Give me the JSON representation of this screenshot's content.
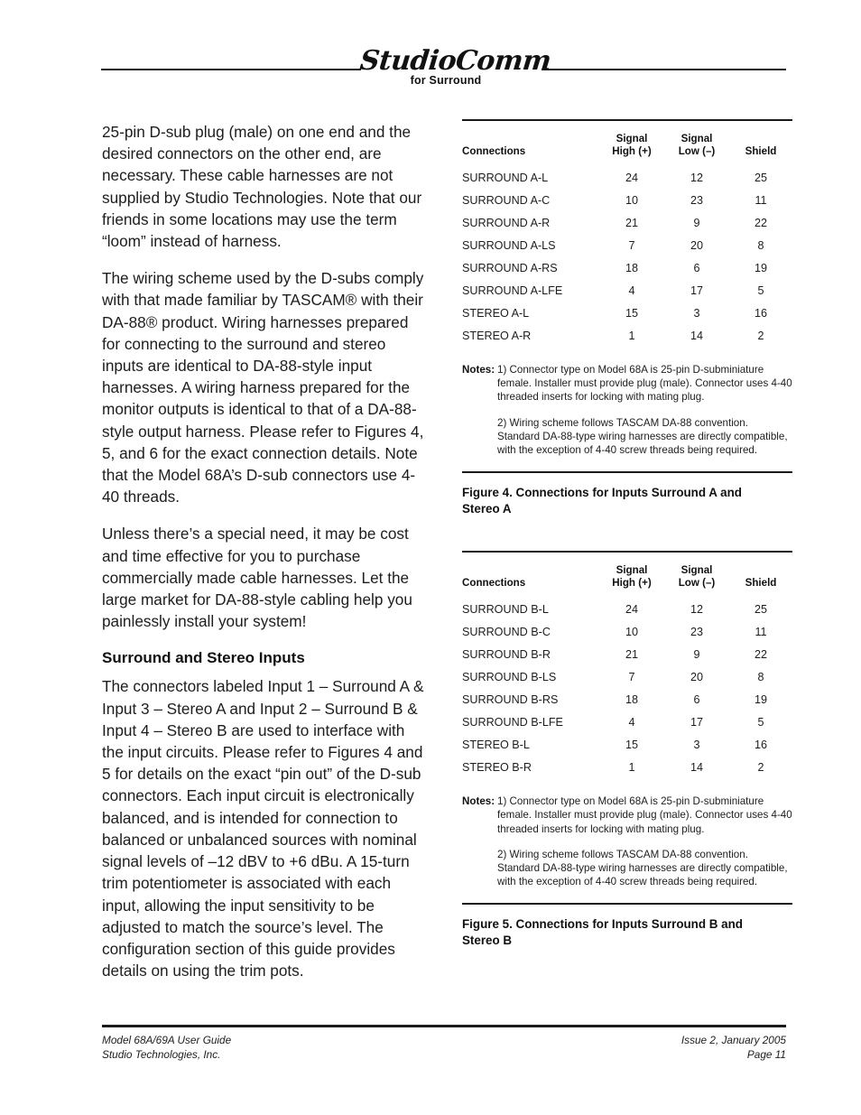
{
  "header": {
    "logo_script": "StudioComm",
    "logo_sub": "for Surround"
  },
  "left_column": {
    "paragraphs": [
      "25-pin D-sub plug (male) on one end and the desired connectors on the other end, are necessary. These cable harnesses are not supplied by Studio Technologies. Note that our friends in some locations may use the term “loom” instead of harness.",
      "The wiring scheme used by the D-subs comply with that made familiar by TASCAM® with their DA-88® product. Wiring harnesses prepared for connecting to the surround and stereo inputs are identical to DA-88-style input harnesses. A wiring harness prepared for the monitor outputs is identical to that of a DA-88-style output harness. Please refer to Figures 4, 5, and 6 for the exact connection details. Note that the Model 68A’s D-sub connectors use 4-40 threads.",
      "Unless there’s a special need, it may be cost and time effective for you to purchase commercially made cable harnesses. Let the large market for DA-88-style cabling help you painlessly install your system!"
    ],
    "section_heading": "Surround and Stereo Inputs",
    "section_paragraph": "The connectors labeled Input 1 – Surround A & Input 3 – Stereo A and Input 2 – Surround B & Input 4 – Stereo B are used to interface with the input circuits. Please refer to Figures 4 and 5 for details on the exact “pin out” of the D-sub connectors. Each input circuit is electronically balanced, and is intended for connection to balanced or unbalanced sources with nominal signal levels of –12 dBV to +6 dBu. A 15-turn trim potentiometer is associated with each input, allowing the input sensitivity to be adjusted to match the source’s level. The configuration section of this guide provides details on using the trim pots."
  },
  "figures": [
    {
      "table": {
        "columns": [
          "Connections",
          "Signal High (+)",
          "Signal Low (–)",
          "Shield"
        ],
        "column_lines": [
          [
            "",
            "Connections"
          ],
          [
            "Signal",
            "High (+)"
          ],
          [
            "Signal",
            "Low (–)"
          ],
          [
            "",
            "Shield"
          ]
        ],
        "rows": [
          [
            "SURROUND A-L",
            "24",
            "12",
            "25"
          ],
          [
            "SURROUND A-C",
            "10",
            "23",
            "11"
          ],
          [
            "SURROUND A-R",
            "21",
            "9",
            "22"
          ],
          [
            "SURROUND A-LS",
            "7",
            "20",
            "8"
          ],
          [
            "SURROUND A-RS",
            "18",
            "6",
            "19"
          ],
          [
            "SURROUND A-LFE",
            "4",
            "17",
            "5"
          ],
          [
            "STEREO A-L",
            "15",
            "3",
            "16"
          ],
          [
            "STEREO A-R",
            "1",
            "14",
            "2"
          ]
        ]
      },
      "notes_label": "Notes:",
      "notes": [
        "1) Connector type on Model 68A is 25-pin D-subminiature female. Installer must provide plug (male). Connector uses 4-40 threaded inserts for locking with mating plug.",
        "2) Wiring scheme follows TASCAM DA-88 convention. Standard DA-88-type wiring harnesses are directly compatible, with the exception of 4-40 screw threads being required."
      ],
      "caption": "Figure 4. Connections for Inputs Surround A and Stereo A"
    },
    {
      "table": {
        "columns": [
          "Connections",
          "Signal High (+)",
          "Signal Low (–)",
          "Shield"
        ],
        "column_lines": [
          [
            "",
            "Connections"
          ],
          [
            "Signal",
            "High (+)"
          ],
          [
            "Signal",
            "Low (–)"
          ],
          [
            "",
            "Shield"
          ]
        ],
        "rows": [
          [
            "SURROUND B-L",
            "24",
            "12",
            "25"
          ],
          [
            "SURROUND B-C",
            "10",
            "23",
            "11"
          ],
          [
            "SURROUND B-R",
            "21",
            "9",
            "22"
          ],
          [
            "SURROUND B-LS",
            "7",
            "20",
            "8"
          ],
          [
            "SURROUND B-RS",
            "18",
            "6",
            "19"
          ],
          [
            "SURROUND B-LFE",
            "4",
            "17",
            "5"
          ],
          [
            "STEREO B-L",
            "15",
            "3",
            "16"
          ],
          [
            "STEREO B-R",
            "1",
            "14",
            "2"
          ]
        ]
      },
      "notes_label": "Notes:",
      "notes": [
        "1) Connector type on Model 68A is 25-pin D-subminiature female. Installer must provide plug (male). Connector uses 4-40 threaded inserts for locking with mating plug.",
        "2) Wiring scheme follows TASCAM DA-88 convention. Standard DA-88-type wiring harnesses are directly compatible, with the exception of 4-40 screw threads being required."
      ],
      "caption": "Figure 5. Connections for Inputs Surround B and Stereo B"
    }
  ],
  "footer": {
    "left_line1": "Model 68A/69A User Guide",
    "left_line2": "Studio Technologies, Inc.",
    "right_line1": "Issue 2, January 2005",
    "right_line2": "Page 11"
  }
}
